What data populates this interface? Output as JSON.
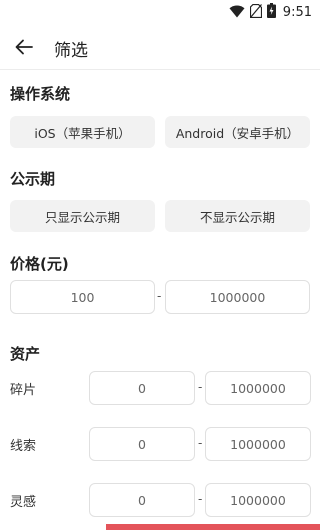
{
  "status_bar": {
    "time": "9:51"
  },
  "header": {
    "title": "筛选"
  },
  "os_section": {
    "title": "操作系统",
    "options": [
      "iOS（苹果手机）",
      "Android（安卓手机）"
    ]
  },
  "public_section": {
    "title": "公示期",
    "options": [
      "只显示公示期",
      "不显示公示期"
    ]
  },
  "price_section": {
    "title": "价格(元)",
    "min_placeholder": "100",
    "max_placeholder": "1000000",
    "separator": "-"
  },
  "assets_section": {
    "title": "资产",
    "rows": [
      {
        "label": "碎片",
        "min": "0",
        "max": "1000000",
        "separator": "-"
      },
      {
        "label": "线索",
        "min": "0",
        "max": "1000000",
        "separator": "-"
      },
      {
        "label": "灵感",
        "min": "0",
        "max": "1000000",
        "separator": "-"
      }
    ]
  },
  "colors": {
    "accent": "#e4545a",
    "chip_bg": "#f2f2f2",
    "border": "#e0e0e0"
  }
}
